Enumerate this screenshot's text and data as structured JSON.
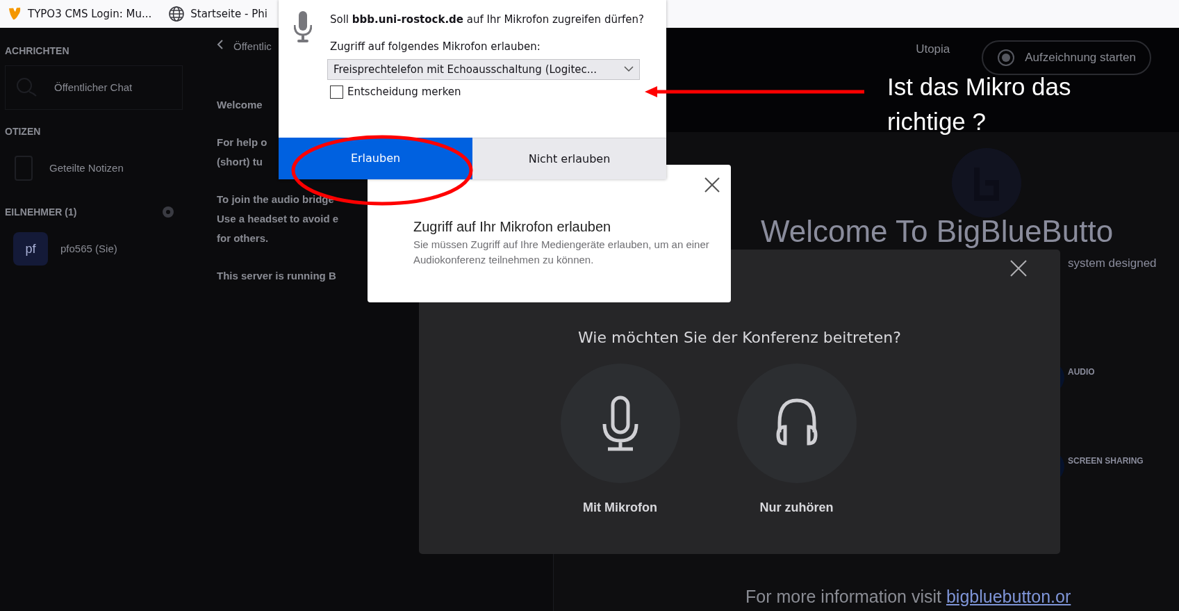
{
  "browser_tabs": [
    {
      "title": "TYPO3 CMS Login: Mu..."
    },
    {
      "title": "Startseite - Phi"
    }
  ],
  "sidebar": {
    "sections": [
      {
        "heading": "ACHRICHTEN",
        "items": [
          {
            "label": "Öffentlicher Chat",
            "kind": "chat"
          }
        ]
      },
      {
        "heading": "OTIZEN",
        "items": [
          {
            "label": "Geteilte Notizen",
            "kind": "note"
          }
        ]
      },
      {
        "heading": "EILNEHMER (1)",
        "users": [
          {
            "avatar": "pf",
            "name": "pfo565 (Sie)"
          }
        ]
      }
    ]
  },
  "chat_panel": {
    "back_label": "Öffentlic",
    "messages": [
      "Welcome",
      "For help o\n(short) tu",
      "To join the audio bridge\nUse a headset to avoid e\nfor others.",
      "This server is running B"
    ]
  },
  "top_bar": {
    "meeting_name": "Utopia",
    "record_button": "Aufzeichnung starten"
  },
  "welcome": {
    "title": "Welcome To BigBlueButto",
    "subtitle": "system designed",
    "features": [
      "AUDIO",
      "SCREEN SHARING"
    ],
    "footer": "For more information visit",
    "footer_link": "bigbluebutton.or"
  },
  "permission_popup": {
    "prompt": "Soll **bbb.uni-rostock.de** auf Ihr Mikrofon zugreifen dürfen?",
    "device_label": "Zugriff auf folgendes Mikrofon erlauben:",
    "device": "Freisprechtelefon mit Echoausschaltung (Logitec...",
    "remember": {
      "label": "Entscheidung merken",
      "checked": false
    },
    "buttons": [
      {
        "label": "Erlauben",
        "kind": "primary"
      },
      {
        "label": "Nicht erlauben",
        "kind": "secondary"
      }
    ]
  },
  "toast": {
    "title": "Zugriff auf Ihr Mikrofon erlauben",
    "text": "Sie müssen Zugriff auf Ihre Mediengeräte erlauben, um an einer Audiokonferenz teilnehmen zu können."
  },
  "audio_modal": {
    "title": "Wie möchten Sie der Konferenz beitreten?",
    "options": [
      {
        "label": "Mit Mikrofon",
        "kind": "microphone"
      },
      {
        "label": "Nur zuhören",
        "kind": "listen"
      }
    ]
  },
  "annotation": {
    "text": "Ist das Mikro das richtige ?"
  }
}
